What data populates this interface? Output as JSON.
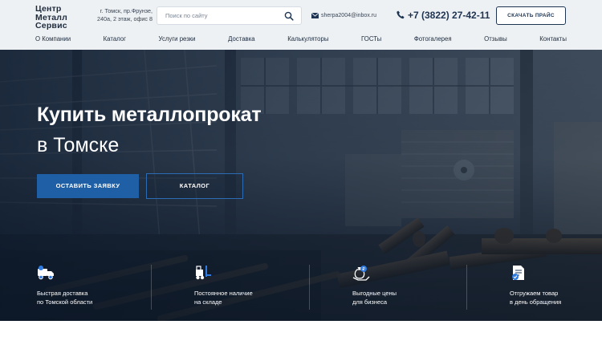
{
  "header": {
    "logo_lines": [
      "Центр",
      "Металл",
      "Сервис"
    ],
    "address": "г. Томск, пр.Фрунзе, 240а, 2 этаж, офис 8",
    "search_placeholder": "Поиск по сайту",
    "email": "sherpa2004@inbox.ru",
    "phone": "+7 (3822) 27-42-11",
    "price_button": "СКАЧАТЬ ПРАЙС"
  },
  "nav": {
    "items": [
      "О Компании",
      "Каталог",
      "Услуги резки",
      "Доставка",
      "Калькуляторы",
      "ГОСТы",
      "Фотогалерея",
      "Отзывы",
      "Контакты"
    ]
  },
  "hero": {
    "title": "Купить металлопрокат",
    "subtitle": "в Томске",
    "request_button": "ОСТАВИТЬ ЗАЯВКУ",
    "catalog_button": "КАТАЛОГ"
  },
  "features": [
    {
      "icon": "truck-icon",
      "line1": "Быстрая доставка",
      "line2": "по Томской области"
    },
    {
      "icon": "forklift-icon",
      "line1": "Постоянное наличие",
      "line2": "на складе"
    },
    {
      "icon": "money-bag-icon",
      "line1": "Выгодные цены",
      "line2": "для бизнеса"
    },
    {
      "icon": "document-icon",
      "line1": "Отгружаем товар",
      "line2": "в день обращения"
    }
  ],
  "colors": {
    "accent": "#1f5fa6",
    "header_bg": "#eef1f4",
    "dark_text": "#1d2b3d"
  }
}
